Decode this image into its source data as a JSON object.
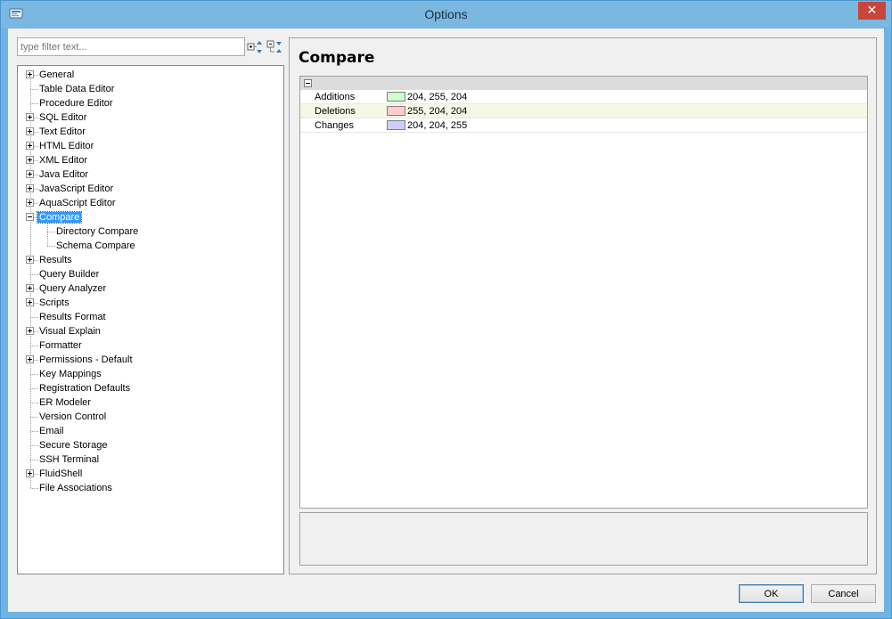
{
  "window": {
    "title": "Options"
  },
  "filter": {
    "placeholder": "type filter text..."
  },
  "tree": {
    "items": [
      {
        "label": "General",
        "expandable": true,
        "expanded": false,
        "level": 0
      },
      {
        "label": "Table Data Editor",
        "expandable": false,
        "level": 0
      },
      {
        "label": "Procedure Editor",
        "expandable": false,
        "level": 0
      },
      {
        "label": "SQL Editor",
        "expandable": true,
        "expanded": false,
        "level": 0
      },
      {
        "label": "Text Editor",
        "expandable": true,
        "expanded": false,
        "level": 0
      },
      {
        "label": "HTML Editor",
        "expandable": true,
        "expanded": false,
        "level": 0
      },
      {
        "label": "XML Editor",
        "expandable": true,
        "expanded": false,
        "level": 0
      },
      {
        "label": "Java Editor",
        "expandable": true,
        "expanded": false,
        "level": 0
      },
      {
        "label": "JavaScript Editor",
        "expandable": true,
        "expanded": false,
        "level": 0
      },
      {
        "label": "AquaScript Editor",
        "expandable": true,
        "expanded": false,
        "level": 0
      },
      {
        "label": "Compare",
        "expandable": true,
        "expanded": true,
        "level": 0,
        "selected": true
      },
      {
        "label": "Directory Compare",
        "expandable": false,
        "level": 1
      },
      {
        "label": "Schema Compare",
        "expandable": false,
        "level": 1
      },
      {
        "label": "Results",
        "expandable": true,
        "expanded": false,
        "level": 0
      },
      {
        "label": "Query Builder",
        "expandable": false,
        "level": 0
      },
      {
        "label": "Query Analyzer",
        "expandable": true,
        "expanded": false,
        "level": 0
      },
      {
        "label": "Scripts",
        "expandable": true,
        "expanded": false,
        "level": 0
      },
      {
        "label": "Results Format",
        "expandable": false,
        "level": 0
      },
      {
        "label": "Visual Explain",
        "expandable": true,
        "expanded": false,
        "level": 0
      },
      {
        "label": "Formatter",
        "expandable": false,
        "level": 0
      },
      {
        "label": "Permissions - Default",
        "expandable": true,
        "expanded": false,
        "level": 0
      },
      {
        "label": "Key Mappings",
        "expandable": false,
        "level": 0
      },
      {
        "label": "Registration Defaults",
        "expandable": false,
        "level": 0
      },
      {
        "label": "ER Modeler",
        "expandable": false,
        "level": 0
      },
      {
        "label": "Version Control",
        "expandable": false,
        "level": 0
      },
      {
        "label": "Email",
        "expandable": false,
        "level": 0
      },
      {
        "label": "Secure Storage",
        "expandable": false,
        "level": 0
      },
      {
        "label": "SSH Terminal",
        "expandable": false,
        "level": 0
      },
      {
        "label": "FluidShell",
        "expandable": true,
        "expanded": false,
        "level": 0
      },
      {
        "label": "File Associations",
        "expandable": false,
        "level": 0
      }
    ]
  },
  "page": {
    "title": "Compare",
    "properties": [
      {
        "name": "Additions",
        "value": "204, 255, 204",
        "color": "#ccffcc"
      },
      {
        "name": "Deletions",
        "value": "255, 204, 204",
        "color": "#ffcccc"
      },
      {
        "name": "Changes",
        "value": "204, 204, 255",
        "color": "#ccccff"
      }
    ]
  },
  "buttons": {
    "ok": "OK",
    "cancel": "Cancel"
  }
}
